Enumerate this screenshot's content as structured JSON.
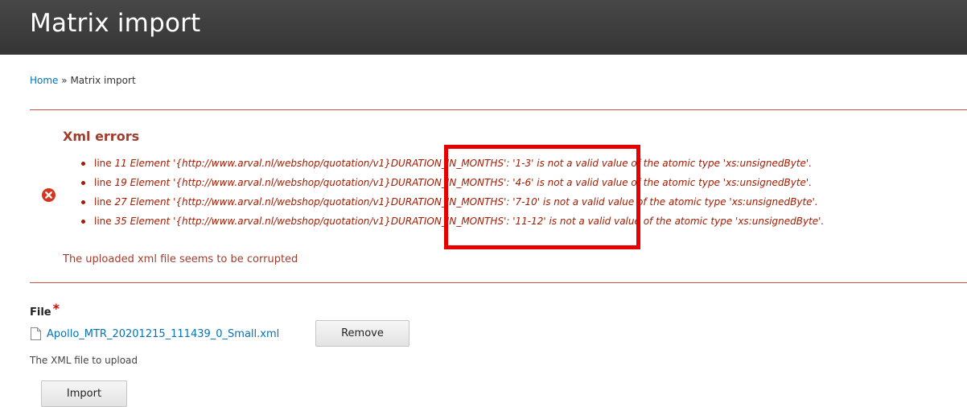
{
  "header": {
    "title": "Matrix import"
  },
  "breadcrumb": {
    "home": "Home",
    "separator": "»",
    "current": "Matrix import"
  },
  "errors": {
    "title": "Xml errors",
    "items": [
      {
        "line_word": "line ",
        "message": "11 Element '{http://www.arval.nl/webshop/quotation/v1}DURATION_IN_MONTHS': '1-3' is not a valid value of the atomic type 'xs:unsignedByte'."
      },
      {
        "line_word": "line ",
        "message": "19 Element '{http://www.arval.nl/webshop/quotation/v1}DURATION_IN_MONTHS': '4-6' is not a valid value of the atomic type 'xs:unsignedByte'."
      },
      {
        "line_word": "line ",
        "message": "27 Element '{http://www.arval.nl/webshop/quotation/v1}DURATION_IN_MONTHS': '7-10' is not a valid value of the atomic type 'xs:unsignedByte'."
      },
      {
        "line_word": "line ",
        "message": "35 Element '{http://www.arval.nl/webshop/quotation/v1}DURATION_IN_MONTHS': '11-12' is not a valid value of the atomic type 'xs:unsignedByte'."
      }
    ],
    "footer": "The uploaded xml file seems to be corrupted"
  },
  "form": {
    "file_label": "File",
    "required_mark": "*",
    "file_name": "Apollo_MTR_20201215_111439_0_Small.xml",
    "remove_label": "Remove",
    "description": "The XML file to upload",
    "import_label": "Import"
  },
  "colors": {
    "header_bg": "#3f3f3f",
    "error_text": "#a51b00",
    "error_border": "#d24e3e",
    "link": "#0074bd",
    "highlight": "#e60000"
  },
  "icons": {
    "error": "error-x-icon",
    "file": "file-icon"
  }
}
